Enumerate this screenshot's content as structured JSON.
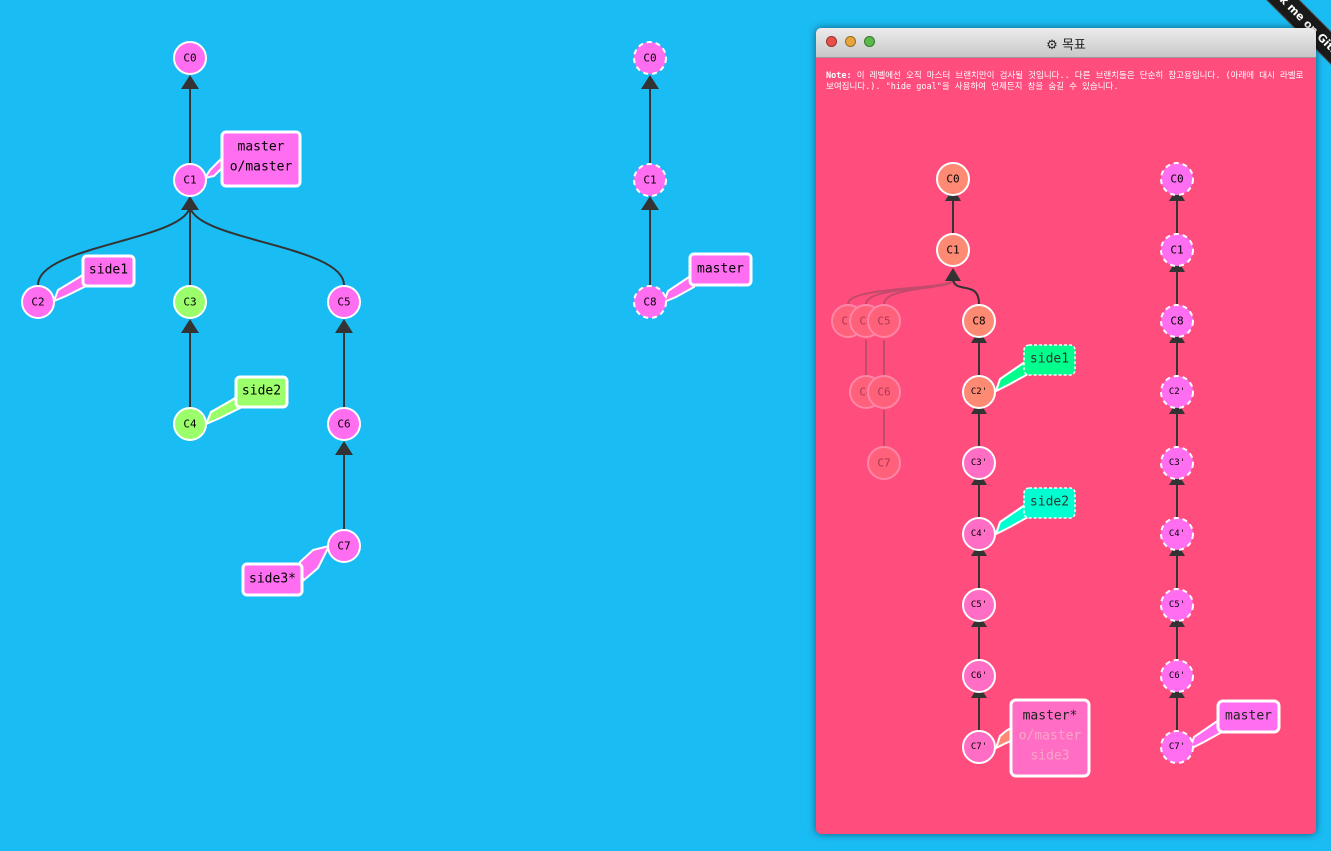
{
  "ribbon": {
    "label": "Fork me on GitHub"
  },
  "main_tree": {
    "nodes": [
      {
        "id": "C0",
        "label": "C0",
        "color": "#ff6ef0"
      },
      {
        "id": "C1",
        "label": "C1",
        "color": "#ff6ef0"
      },
      {
        "id": "C2",
        "label": "C2",
        "color": "#ff6ef0"
      },
      {
        "id": "C3",
        "label": "C3",
        "color": "#9bff6b"
      },
      {
        "id": "C4",
        "label": "C4",
        "color": "#9bff6b"
      },
      {
        "id": "C5",
        "label": "C5",
        "color": "#ff6ef0"
      },
      {
        "id": "C6",
        "label": "C6",
        "color": "#ff6ef0"
      },
      {
        "id": "C7",
        "label": "C7",
        "color": "#ff6ef0"
      }
    ],
    "branches": [
      {
        "id": "master",
        "lines": [
          "master",
          "o/master"
        ],
        "color": "#ff6ef0",
        "target": "C1"
      },
      {
        "id": "side1",
        "lines": [
          "side1"
        ],
        "color": "#ff6ef0",
        "target": "C2"
      },
      {
        "id": "side2",
        "lines": [
          "side2"
        ],
        "color": "#9bff6b",
        "target": "C4"
      },
      {
        "id": "side3",
        "lines": [
          "side3*"
        ],
        "color": "#ff6ef0",
        "target": "C7"
      }
    ]
  },
  "origin_tree": {
    "nodes": [
      {
        "id": "C0",
        "label": "C0"
      },
      {
        "id": "C1",
        "label": "C1"
      },
      {
        "id": "C8",
        "label": "C8"
      }
    ],
    "branches": [
      {
        "id": "master",
        "lines": [
          "master"
        ],
        "target": "C8"
      }
    ]
  },
  "goal_window": {
    "title_icon": "gear-icon",
    "title": "목표",
    "note_prefix": "Note:",
    "note_text": " 이 레벨에선 오직 마스터 브랜치만이 검사될 것입니다.. 다른 브랜치들은 단순히 참고용입니다. (아래에 대시 라벨로 보여집니다.). \"hide goal\"을 사용하여 언제든지 창을 숨길 수 있습니다.",
    "ghost_nodes": [
      "C2",
      "C3",
      "C5",
      "C4",
      "C6",
      "C7"
    ],
    "local_nodes": [
      "C0",
      "C1",
      "C8",
      "C2'",
      "C3'",
      "C4'",
      "C5'",
      "C6'",
      "C7'"
    ],
    "remote_nodes": [
      "C0",
      "C1",
      "C8",
      "C2'",
      "C3'",
      "C4'",
      "C5'",
      "C6'",
      "C7'"
    ],
    "branches": {
      "side1": "side1",
      "side2": "side2",
      "master_box": [
        "master*",
        "o/master",
        "side3"
      ],
      "remote_master": "master"
    },
    "colors": {
      "background": "#ff4d7e",
      "salmon": "#ff8a73",
      "side1": "#00ff8c",
      "side2": "#00ffd0",
      "pink": "#ff6ef0"
    }
  }
}
